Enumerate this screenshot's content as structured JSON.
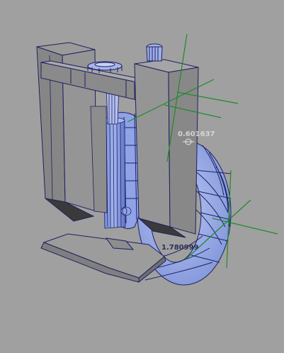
{
  "viewport": {
    "background": "#a0a0a0",
    "wire_color": "#1e2060",
    "shaded_fill": "#8c8c8c",
    "selected_fill": "#8fa3e6",
    "manipulator_color": "#1f8a2a"
  },
  "readouts": {
    "a": "0.601637",
    "b": "1.780999"
  },
  "icons": {
    "pivot": "pivot-handle-icon"
  }
}
